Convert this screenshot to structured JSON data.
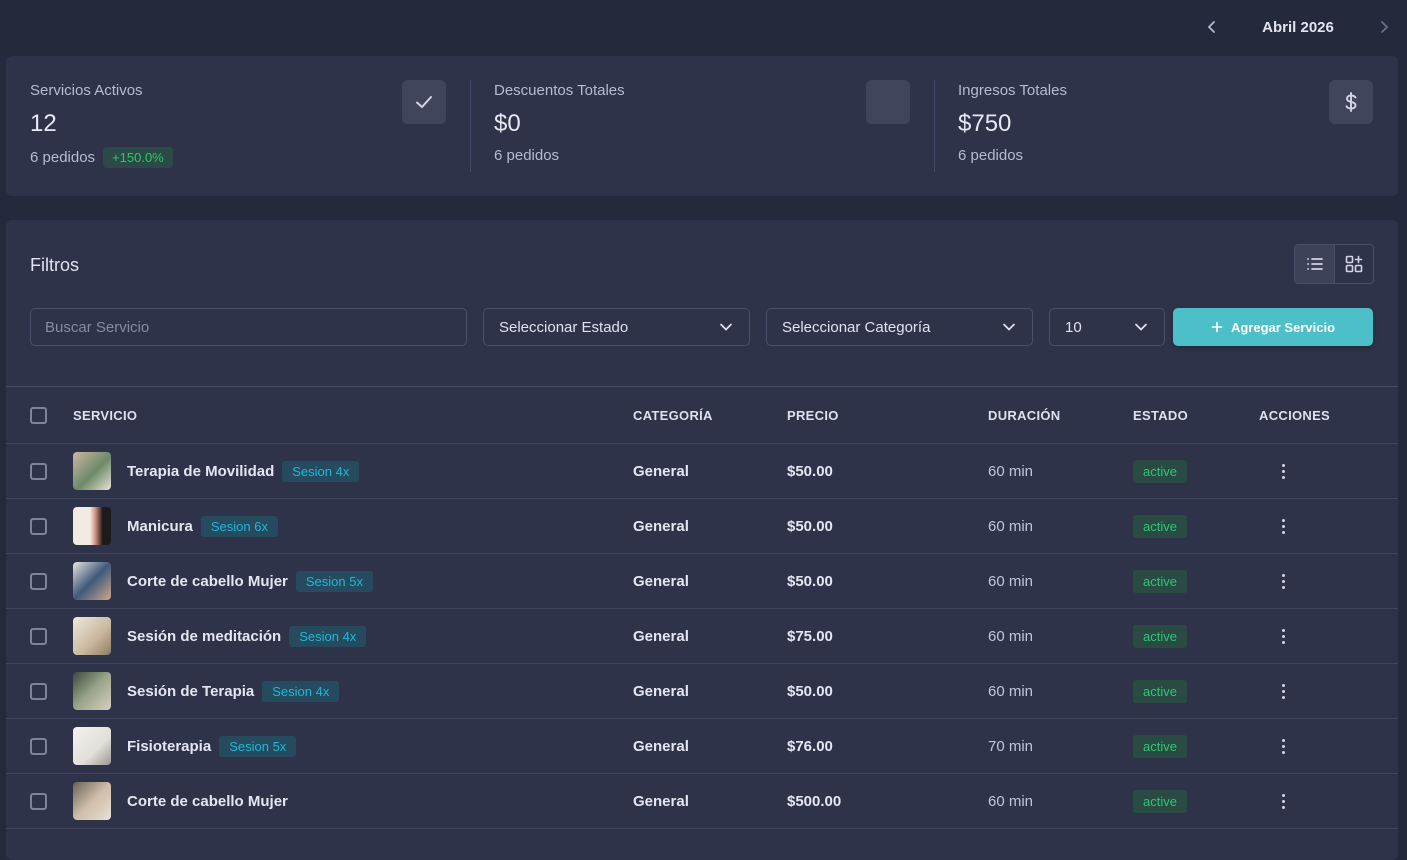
{
  "header": {
    "month": "Abril 2026",
    "prev_icon": "chevron-left-icon",
    "next_icon": "chevron-right-icon"
  },
  "stats": [
    {
      "title": "Servicios Activos",
      "value": "12",
      "sub": "6 pedidos",
      "badge": "+150.0%",
      "icon": "check-icon"
    },
    {
      "title": "Descuentos Totales",
      "value": "$0",
      "sub": "6 pedidos",
      "icon": "blank-icon"
    },
    {
      "title": "Ingresos Totales",
      "value": "$750",
      "sub": "6 pedidos",
      "icon": "dollar-icon"
    }
  ],
  "filters": {
    "title": "Filtros",
    "search_placeholder": "Buscar Servicio",
    "status_select": "Seleccionar Estado",
    "category_select": "Seleccionar Categoría",
    "page_size": "10",
    "add_button": "Agregar Servicio"
  },
  "table": {
    "columns": [
      "SERVICIO",
      "CATEGORÍA",
      "PRECIO",
      "DURACIÓN",
      "ESTADO",
      "ACCIONES"
    ],
    "rows": [
      {
        "name": "Terapia de Movilidad",
        "session": "Sesion 4x",
        "category": "General",
        "price": "$50.00",
        "duration": "60 min",
        "status": "active"
      },
      {
        "name": "Manicura",
        "session": "Sesion 6x",
        "category": "General",
        "price": "$50.00",
        "duration": "60 min",
        "status": "active"
      },
      {
        "name": "Corte de cabello Mujer",
        "session": "Sesion 5x",
        "category": "General",
        "price": "$50.00",
        "duration": "60 min",
        "status": "active"
      },
      {
        "name": "Sesión de meditación",
        "session": "Sesion 4x",
        "category": "General",
        "price": "$75.00",
        "duration": "60 min",
        "status": "active"
      },
      {
        "name": "Sesión de Terapia",
        "session": "Sesion 4x",
        "category": "General",
        "price": "$50.00",
        "duration": "60 min",
        "status": "active"
      },
      {
        "name": "Fisioterapia",
        "session": "Sesion 5x",
        "category": "General",
        "price": "$76.00",
        "duration": "70 min",
        "status": "active"
      },
      {
        "name": "Corte de cabello Mujer",
        "session": "",
        "category": "General",
        "price": "$500.00",
        "duration": "60 min",
        "status": "active"
      }
    ]
  },
  "colors": {
    "background": "#25293c",
    "card": "#2f3349",
    "accent": "#4dbfc9",
    "success": "#28c76f",
    "info": "#1fb8d8"
  }
}
